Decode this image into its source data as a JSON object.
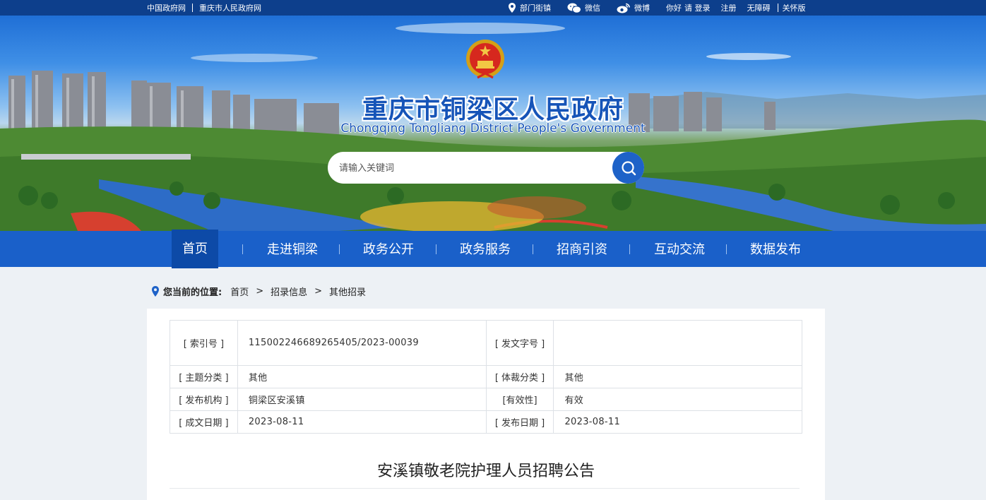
{
  "topbar": {
    "left_links": [
      "中国政府网",
      "重庆市人民政府网"
    ],
    "dept_label": "部门街镇",
    "wechat_label": "微信",
    "weibo_label": "微博",
    "greeting": "你好",
    "login_label": "请 登录",
    "register_label": "注册",
    "accessible_label": "无障碍",
    "care_label": "关怀版"
  },
  "banner": {
    "title": "重庆市铜梁区人民政府",
    "subtitle": "Chongqing Tongliang District People's Government",
    "search_placeholder": "请输入关键词"
  },
  "nav": {
    "items": [
      "首页",
      "走进铜梁",
      "政务公开",
      "政务服务",
      "招商引资",
      "互动交流",
      "数据发布"
    ],
    "active": "首页"
  },
  "breadcrumb": {
    "label": "您当前的位置:",
    "items": [
      "首页",
      "招录信息",
      "其他招录"
    ],
    "separator": ">"
  },
  "meta": {
    "index_key": "[ 索引号 ]",
    "index_val": "115002246689265405/2023-00039",
    "docno_key": "[ 发文字号 ]",
    "docno_val": "",
    "topic_key": "[ 主题分类 ]",
    "topic_val": "其他",
    "genre_key": "[ 体裁分类 ]",
    "genre_val": "其他",
    "org_key": "[ 发布机构 ]",
    "org_val": "铜梁区安溪镇",
    "validity_key": "[有效性]",
    "validity_val": "有效",
    "created_key": "[ 成文日期 ]",
    "created_val": "2023-08-11",
    "published_key": "[ 发布日期 ]",
    "published_val": "2023-08-11"
  },
  "article": {
    "title": "安溪镇敬老院护理人员招聘公告"
  },
  "colors": {
    "topbar": "#0d3f8c",
    "nav": "#1a60c9",
    "nav_active": "#0d4aa7",
    "title_blue": "#1654b8",
    "page_bg": "#edf1f5"
  }
}
